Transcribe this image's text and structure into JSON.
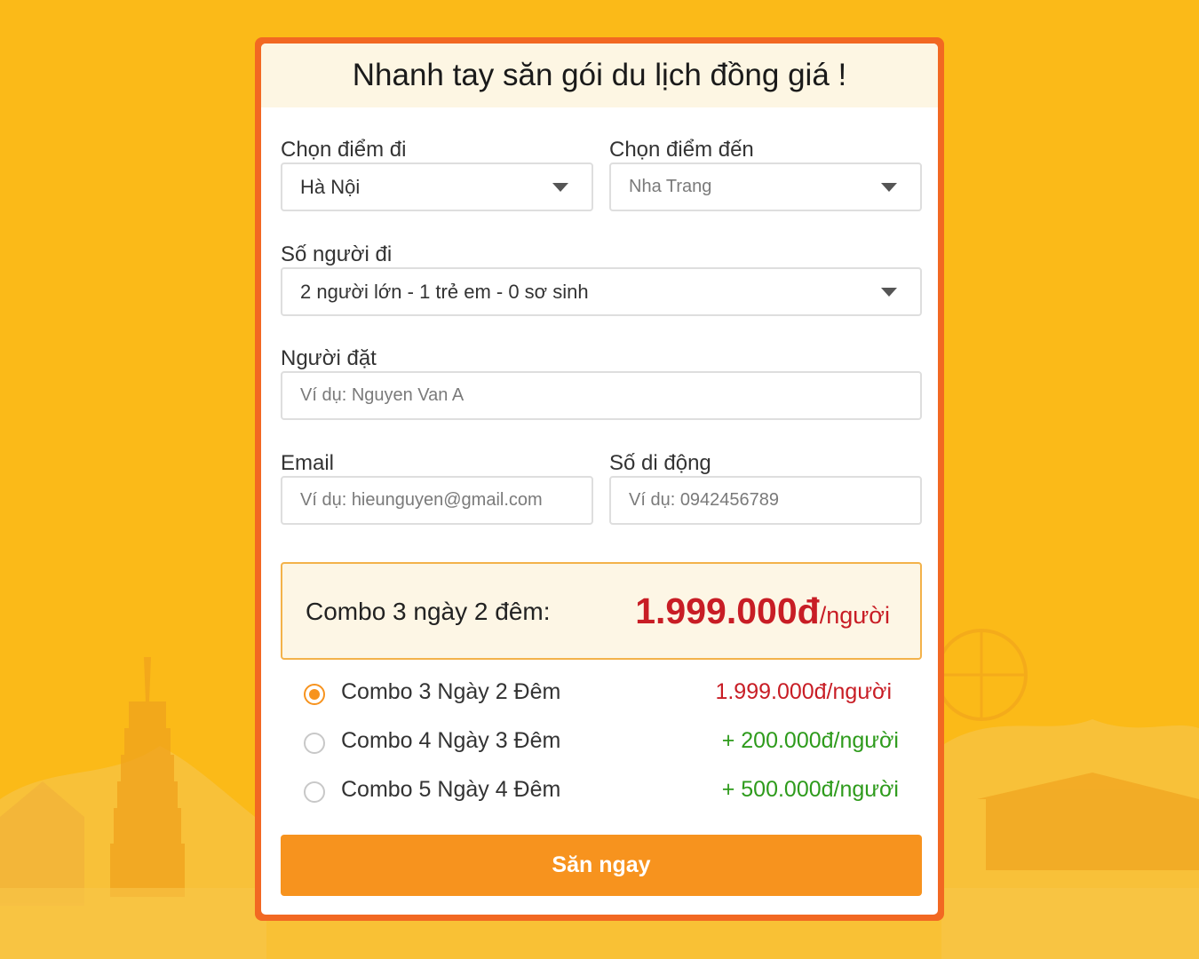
{
  "form": {
    "title": "Nhanh tay săn gói du lịch đồng giá !",
    "departure": {
      "label": "Chọn điểm đi",
      "value": "Hà Nội"
    },
    "destination": {
      "label": "Chọn điểm đến",
      "value": "Nha Trang"
    },
    "travelers": {
      "label": "Số người đi",
      "value": "2 người lớn - 1 trẻ em - 0 sơ sinh"
    },
    "booker": {
      "label": "Người đặt",
      "placeholder": "Ví dụ: Nguyen Van A"
    },
    "email": {
      "label": "Email",
      "placeholder": "Ví dụ: hieunguyen@gmail.com"
    },
    "phone": {
      "label": "Số di động",
      "placeholder": "Ví dụ: 0942456789"
    },
    "summary": {
      "combo_name": "Combo 3 ngày 2 đêm:",
      "price_amount": "1.999.000đ",
      "price_unit": "/người"
    },
    "options": [
      {
        "label": "Combo 3 Ngày 2 Đêm",
        "price": "1.999.000đ/người",
        "selected": true
      },
      {
        "label": "Combo 4 Ngày 3 Đêm",
        "price": "+ 200.000đ/người",
        "selected": false
      },
      {
        "label": "Combo 5 Ngày 4 Đêm",
        "price": "+ 500.000đ/người",
        "selected": false
      }
    ],
    "submit_label": "Săn ngay"
  },
  "colors": {
    "background": "#fbba18",
    "card_border": "#f26822",
    "accent": "#f7931e",
    "price_red": "#c81d25",
    "price_green": "#2e9b1c"
  },
  "icons": {
    "select_caret": "caret-down-icon"
  }
}
